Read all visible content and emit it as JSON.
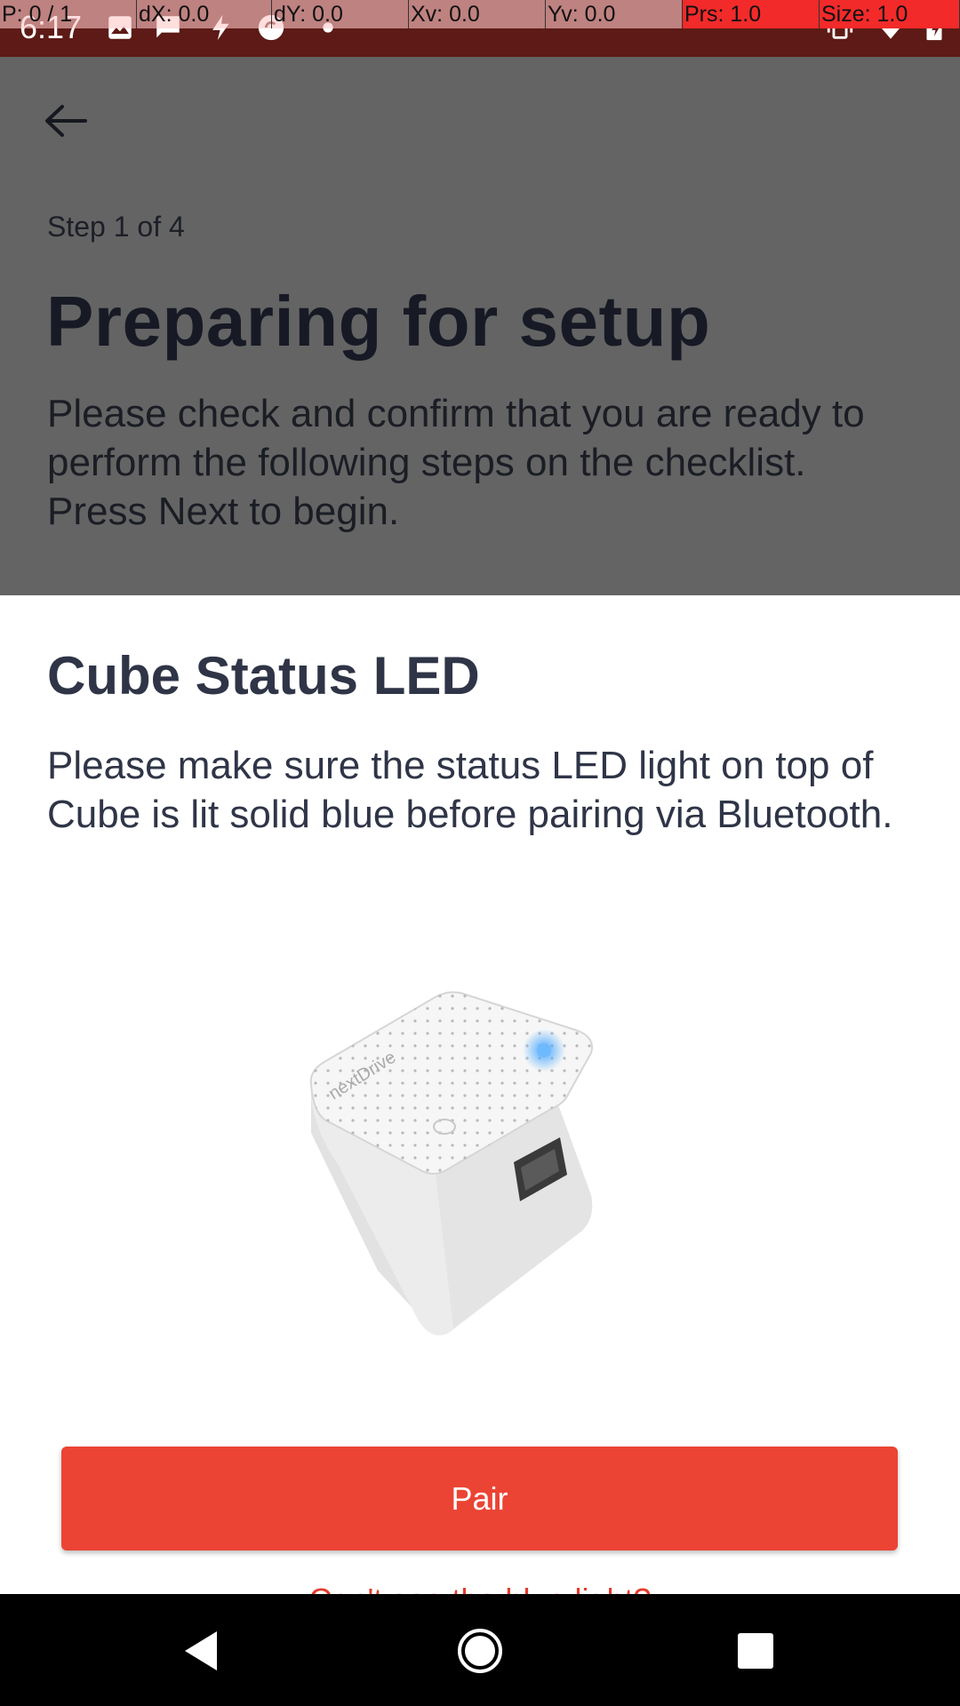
{
  "status_bar": {
    "time": "6:17",
    "left_icons": [
      "image-icon",
      "message-icon",
      "bolt-icon",
      "sync-icon",
      "dot-icon"
    ],
    "right_icons": [
      "vibrate-icon",
      "wifi-icon",
      "battery-icon"
    ]
  },
  "pointer_overlay": {
    "cells": [
      "P: 0 / 1",
      "dX: 0.0",
      "dY: 0.0",
      "Xv: 0.0",
      "Yv: 0.0",
      "Prs: 1.0",
      "Size: 1.0"
    ]
  },
  "page": {
    "step": "Step 1 of 4",
    "title": "Preparing for setup",
    "intro": "Please check and confirm that you are ready to perform the following steps on the checklist. Press Next to begin."
  },
  "sheet": {
    "title": "Cube Status LED",
    "text": "Please make sure the status LED light on top of Cube is lit solid blue before pairing via Bluetooth.",
    "image_brand": "nextDrive",
    "pair_label": "Pair",
    "help_link": "Can't see the blue light?"
  },
  "colors": {
    "accent": "#eb4434",
    "status_bar": "#5d1a16",
    "dim_overlay": "#646464",
    "led": "#4aa8ff"
  }
}
